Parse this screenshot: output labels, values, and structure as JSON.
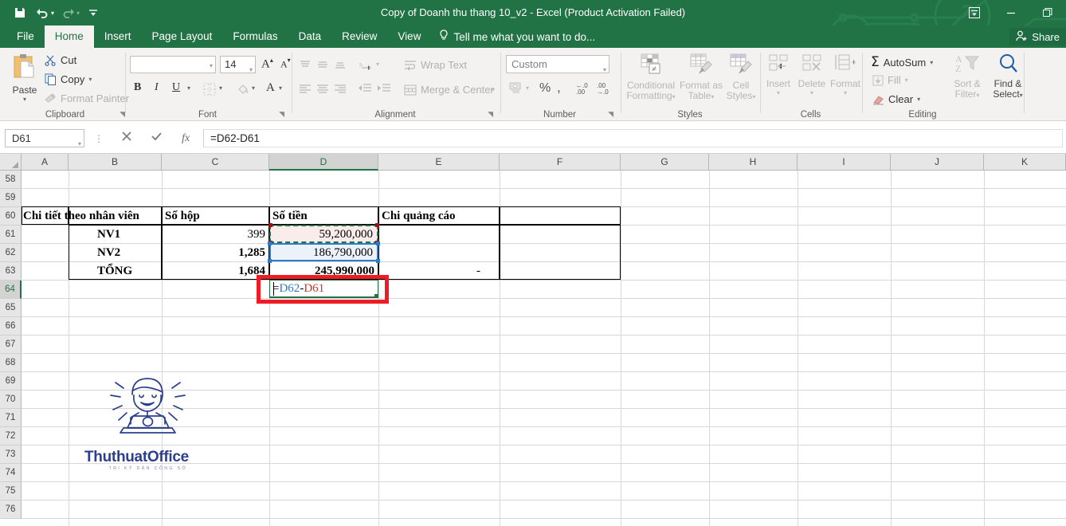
{
  "titlebar": {
    "document_title": "Copy of Doanh thu thang 10_v2 - Excel (Product Activation Failed)",
    "qat": [
      {
        "name": "save-icon",
        "label": "Save"
      },
      {
        "name": "undo-icon",
        "label": "Undo"
      },
      {
        "name": "redo-icon",
        "label": "Redo"
      },
      {
        "name": "customize-qat-icon",
        "label": "Customize Quick Access Toolbar"
      }
    ],
    "window_controls": [
      {
        "name": "ribbon-display-options-button",
        "label": "Ribbon Display Options"
      },
      {
        "name": "minimize-button",
        "label": "Minimize"
      },
      {
        "name": "restore-button",
        "label": "Restore Down"
      }
    ]
  },
  "tabs": [
    {
      "label": "File",
      "active": false
    },
    {
      "label": "Home",
      "active": true
    },
    {
      "label": "Insert",
      "active": false
    },
    {
      "label": "Page Layout",
      "active": false
    },
    {
      "label": "Formulas",
      "active": false
    },
    {
      "label": "Data",
      "active": false
    },
    {
      "label": "Review",
      "active": false
    },
    {
      "label": "View",
      "active": false
    }
  ],
  "tellme": {
    "label": "Tell me what you want to do..."
  },
  "share": {
    "label": "Share"
  },
  "ribbon": {
    "clipboard": {
      "group_label": "Clipboard",
      "paste_label": "Paste",
      "cut_label": "Cut",
      "copy_label": "Copy",
      "format_painter_label": "Format Painter"
    },
    "font": {
      "group_label": "Font",
      "font_name_value": "",
      "font_name_placeholder": "",
      "font_size_value": "14",
      "grow_font_label": "A",
      "shrink_font_label": "A",
      "bold_label": "B",
      "italic_label": "I",
      "underline_label": "U",
      "borders_label": "Borders",
      "fill_color_label": "Fill Color",
      "font_color_label": "A"
    },
    "alignment": {
      "group_label": "Alignment",
      "wrap_text_label": "Wrap Text",
      "merge_center_label": "Merge & Center",
      "orientation_label": "Orientation"
    },
    "number": {
      "group_label": "Number",
      "format_value": "Custom",
      "percent_label": "%",
      "comma_label": ",",
      "increase_decimal_label": ".00",
      "decrease_decimal_label": ".00"
    },
    "styles": {
      "group_label": "Styles",
      "conditional_formatting_label": "Conditional\nFormatting",
      "conditional_formatting_line1": "Conditional",
      "conditional_formatting_line2": "Formatting",
      "format_as_table_line1": "Format as",
      "format_as_table_line2": "Table",
      "cell_styles_line1": "Cell",
      "cell_styles_line2": "Styles"
    },
    "cells": {
      "group_label": "Cells",
      "insert_label": "Insert",
      "delete_label": "Delete",
      "format_label": "Format"
    },
    "editing": {
      "group_label": "Editing",
      "autosum_label": "AutoSum",
      "fill_label": "Fill",
      "clear_label": "Clear",
      "sort_filter_line1": "Sort &",
      "sort_filter_line2": "Filter",
      "find_select_line1": "Find &",
      "find_select_line2": "Select"
    }
  },
  "formula_bar": {
    "name_box_value": "D61",
    "cancel_label": "Cancel",
    "enter_label": "Enter",
    "insert_function_label": "fx",
    "formula_value": "=D62-D61"
  },
  "grid": {
    "columns": [
      "A",
      "B",
      "C",
      "D",
      "E",
      "F",
      "G",
      "H",
      "I",
      "J",
      "K"
    ],
    "selected_column": "D",
    "rows": [
      58,
      59,
      60,
      61,
      62,
      63,
      64,
      65,
      66,
      67,
      68,
      69,
      70,
      71,
      72,
      73,
      74,
      75,
      76
    ],
    "selected_row": 64,
    "cells": {
      "b60": "Chi tiết theo nhân viên",
      "c60": "Số hộp",
      "d60": "Số tiền",
      "e60": "Chi quảng cáo",
      "b61": "NV1",
      "c61": "399",
      "d61": "59,200,000",
      "b62": "NV2",
      "c62": "1,285",
      "d62": "186,790,000",
      "b63": "TỔNG",
      "c63": "1,684",
      "d63": "245,990,000",
      "e63": "-"
    },
    "editing_cell": {
      "address": "D64",
      "formula_prefix": "=",
      "ref1": "D62",
      "operator": "-",
      "ref2": "D61"
    },
    "colors": {
      "accent": "#217346",
      "ref1": "#2c7ac9",
      "ref2": "#c0392b",
      "annotation": "#ee1c25"
    }
  },
  "watermark": {
    "brand": "ThuthuatOffice",
    "tagline": "TRI KỶ DÂN CÔNG SỞ"
  }
}
